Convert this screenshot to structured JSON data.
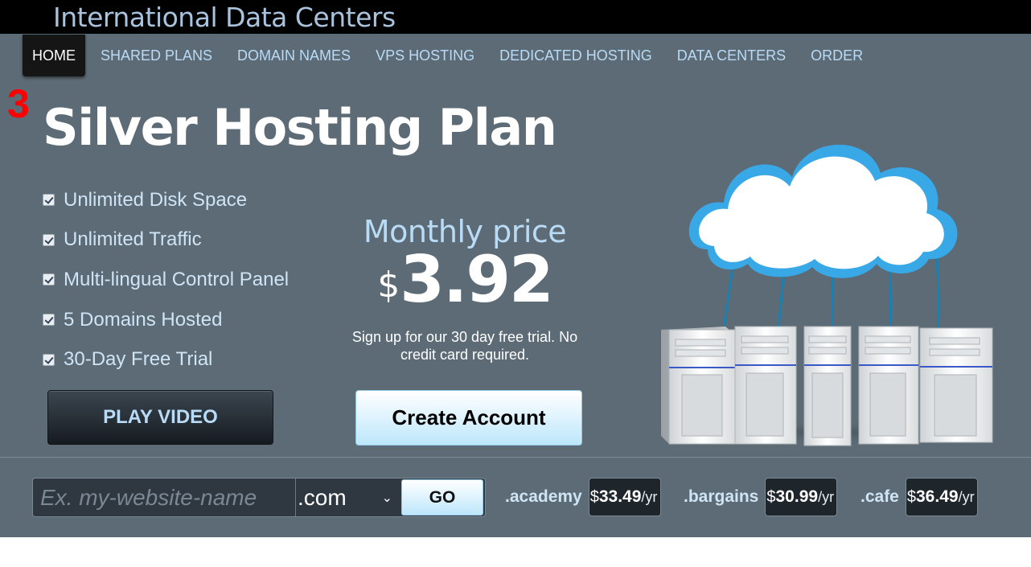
{
  "brand": {
    "name": "International Data Centers"
  },
  "nav": {
    "items": [
      {
        "label": "HOME"
      },
      {
        "label": "SHARED PLANS"
      },
      {
        "label": "DOMAIN NAMES"
      },
      {
        "label": "VPS HOSTING"
      },
      {
        "label": "DEDICATED HOSTING"
      },
      {
        "label": "DATA CENTERS"
      },
      {
        "label": "ORDER"
      }
    ],
    "active": "HOME"
  },
  "hero": {
    "marker": "3",
    "title": "Silver Hosting Plan",
    "features": [
      {
        "label": "Unlimited Disk Space"
      },
      {
        "label": "Unlimited Traffic"
      },
      {
        "label": "Multi-lingual Control Panel"
      },
      {
        "label": "5 Domains Hosted"
      },
      {
        "label": "30-Day Free Trial"
      }
    ],
    "price_label": "Monthly price",
    "currency": "$",
    "price": "3.92",
    "trial_note": "Sign up for our 30 day free trial. No credit card required.",
    "play_button": "PLAY VIDEO",
    "create_button": "Create Account",
    "art_icon": "cloud-servers-illustration"
  },
  "domain_search": {
    "placeholder": "Ex. my-website-name",
    "value": "",
    "selected_tld": ".com",
    "go_label": "GO",
    "offers": [
      {
        "tld": ".academy",
        "currency": "$",
        "price": "33.49",
        "unit": "/yr"
      },
      {
        "tld": ".bargains",
        "currency": "$",
        "price": "30.99",
        "unit": "/yr"
      },
      {
        "tld": ".cafe",
        "currency": "$",
        "price": "36.49",
        "unit": "/yr"
      }
    ]
  },
  "colors": {
    "header_bg": "#000000",
    "hero_bg": "#5c6b75",
    "accent_text": "#b9dbf6",
    "marker": "#ff0000",
    "cta_gradient_end": "#bde7fb"
  }
}
